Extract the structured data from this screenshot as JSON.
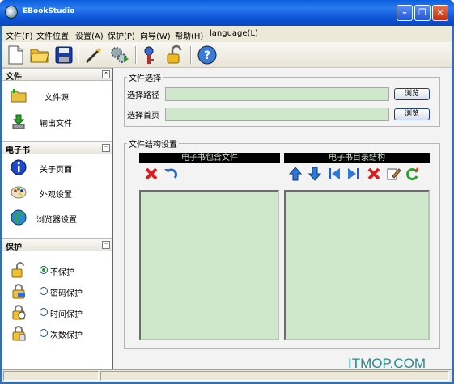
{
  "window": {
    "title": "EBookStudio"
  },
  "menu": [
    "文件(F)",
    "文件位置",
    "设置(A)",
    "保护(P)",
    "向导(W)",
    "帮助(H)",
    "language(L)"
  ],
  "toolbar_icons": [
    "new-document-icon",
    "open-folder-icon",
    "save-icon",
    "magic-wand-icon",
    "gears-play-icon",
    "key-icon",
    "padlock-icon",
    "help-icon"
  ],
  "sidebar": {
    "file": {
      "header": "文件",
      "items": [
        "文件源",
        "输出文件"
      ]
    },
    "ebook": {
      "header": "电子书",
      "items": [
        "关于页面",
        "外观设置",
        "浏览器设置"
      ]
    },
    "protect": {
      "header": "保护",
      "items": [
        "不保护",
        "密码保护",
        "时间保护",
        "次数保护"
      ],
      "selected": "不保护"
    }
  },
  "file_select": {
    "legend": "文件选择",
    "path_label": "选择路径",
    "home_label": "选择首页",
    "browse_label": "浏览",
    "path_value": "",
    "home_value": ""
  },
  "structure": {
    "legend": "文件结构设置",
    "left_header": "电子书包含文件",
    "right_header": "电子书目录结构"
  },
  "watermark": "ITMOP.COM"
}
